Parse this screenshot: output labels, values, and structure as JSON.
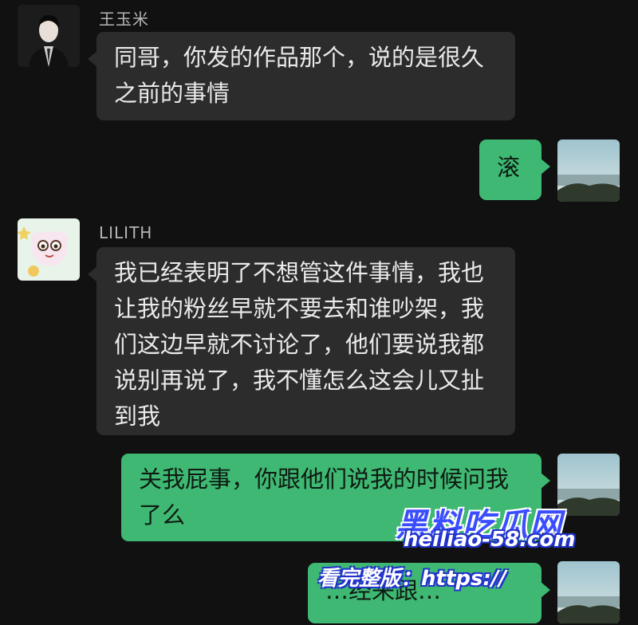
{
  "messages": [
    {
      "sender": "王玉米",
      "side": "left",
      "lines": [
        "同哥，你发的作品那个，说的是很久",
        "之前的事情"
      ]
    },
    {
      "side": "right",
      "lines": [
        "滚"
      ]
    },
    {
      "sender": "LILITH",
      "side": "left",
      "lines": [
        "我已经表明了不想管这件事情，我也",
        "让我的粉丝早就不要去和谁吵架，我",
        "们这边早就不讨论了，他们要说我都",
        "说别再说了，我不懂怎么这会儿又扯",
        "到我"
      ]
    },
    {
      "side": "right",
      "lines": [
        "关我屁事，你跟他们说我的时候问我",
        "了么"
      ]
    },
    {
      "side": "right",
      "lines": [
        "…经来跟…"
      ]
    }
  ],
  "watermark": {
    "logo": "黑料吃瓜网",
    "url": "heiliao-58.com",
    "prefix": "看完整版：https://"
  },
  "colors": {
    "background": "#111111",
    "incoming_bubble": "#2c2c2c",
    "outgoing_bubble": "#3eb872"
  },
  "icons": [
    "man-in-suit-avatar",
    "cartoon-sheep-avatar",
    "landscape-avatar"
  ]
}
